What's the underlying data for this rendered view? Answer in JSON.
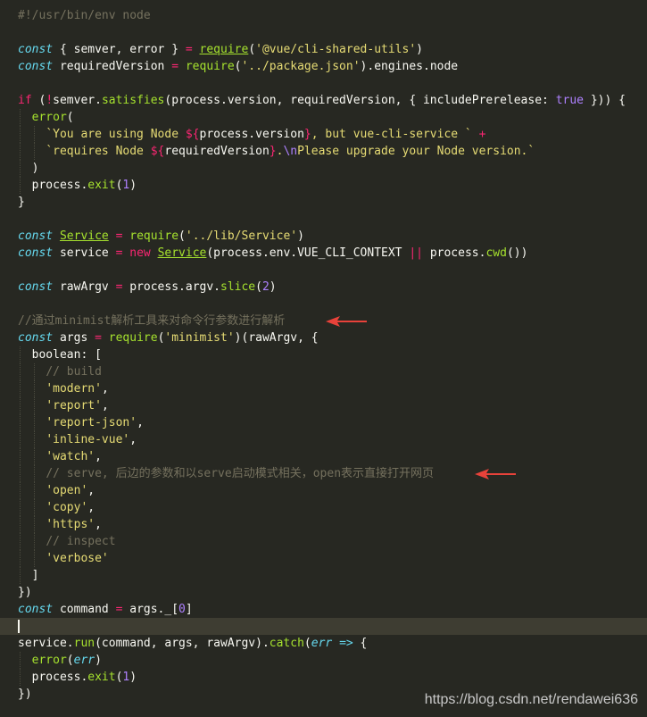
{
  "editor": {
    "theme_colors": {
      "background": "#272822",
      "keyword": "#f92672",
      "storage": "#66d9ef",
      "function": "#a6e22e",
      "string": "#e6db74",
      "comment": "#75715e",
      "number": "#ae81ff",
      "annotation_arrow": "#e8423a"
    },
    "lines": [
      {
        "tokens": [
          {
            "t": "c",
            "v": "#!/usr/bin/env node"
          }
        ]
      },
      {
        "tokens": []
      },
      {
        "tokens": [
          {
            "t": "st",
            "v": "const"
          },
          {
            "t": "p",
            "v": " { semver, error } "
          },
          {
            "t": "kw",
            "v": "="
          },
          {
            "t": "p",
            "v": " "
          },
          {
            "t": "fn",
            "v": "require",
            "u": true
          },
          {
            "t": "p",
            "v": "("
          },
          {
            "t": "s",
            "v": "'@vue/cli-shared-utils'"
          },
          {
            "t": "p",
            "v": ")"
          }
        ]
      },
      {
        "tokens": [
          {
            "t": "st",
            "v": "const"
          },
          {
            "t": "p",
            "v": " requiredVersion "
          },
          {
            "t": "kw",
            "v": "="
          },
          {
            "t": "p",
            "v": " "
          },
          {
            "t": "fn",
            "v": "require"
          },
          {
            "t": "p",
            "v": "("
          },
          {
            "t": "s",
            "v": "'../package.json'"
          },
          {
            "t": "p",
            "v": ").engines.node"
          }
        ]
      },
      {
        "tokens": []
      },
      {
        "tokens": [
          {
            "t": "kw",
            "v": "if"
          },
          {
            "t": "p",
            "v": " ("
          },
          {
            "t": "kw",
            "v": "!"
          },
          {
            "t": "p",
            "v": "semver."
          },
          {
            "t": "fn",
            "v": "satisfies"
          },
          {
            "t": "p",
            "v": "(process.version, requiredVersion, { includePrerelease: "
          },
          {
            "t": "n",
            "v": "true"
          },
          {
            "t": "p",
            "v": " })) {"
          }
        ]
      },
      {
        "guides": [
          1
        ],
        "tokens": [
          {
            "t": "p",
            "v": "  "
          },
          {
            "t": "fn",
            "v": "error"
          },
          {
            "t": "p",
            "v": "("
          }
        ]
      },
      {
        "guides": [
          1,
          2
        ],
        "tokens": [
          {
            "t": "p",
            "v": "    "
          },
          {
            "t": "s",
            "v": "`You are using Node "
          },
          {
            "t": "kw",
            "v": "${"
          },
          {
            "t": "p",
            "v": "process.version"
          },
          {
            "t": "kw",
            "v": "}"
          },
          {
            "t": "s",
            "v": ", but vue-cli-service ` "
          },
          {
            "t": "kw",
            "v": "+"
          }
        ]
      },
      {
        "guides": [
          1,
          2
        ],
        "tokens": [
          {
            "t": "p",
            "v": "    "
          },
          {
            "t": "s",
            "v": "`requires Node "
          },
          {
            "t": "kw",
            "v": "${"
          },
          {
            "t": "p",
            "v": "requiredVersion"
          },
          {
            "t": "kw",
            "v": "}"
          },
          {
            "t": "s",
            "v": "."
          },
          {
            "t": "n",
            "v": "\\n"
          },
          {
            "t": "s",
            "v": "Please upgrade your Node version.`"
          }
        ]
      },
      {
        "guides": [
          1
        ],
        "tokens": [
          {
            "t": "p",
            "v": "  )"
          }
        ]
      },
      {
        "guides": [
          1
        ],
        "tokens": [
          {
            "t": "p",
            "v": "  process."
          },
          {
            "t": "fn",
            "v": "exit"
          },
          {
            "t": "p",
            "v": "("
          },
          {
            "t": "n",
            "v": "1"
          },
          {
            "t": "p",
            "v": ")"
          }
        ]
      },
      {
        "tokens": [
          {
            "t": "p",
            "v": "}"
          }
        ]
      },
      {
        "tokens": []
      },
      {
        "tokens": [
          {
            "t": "st",
            "v": "const"
          },
          {
            "t": "p",
            "v": " "
          },
          {
            "t": "fn",
            "v": "Service",
            "u": true
          },
          {
            "t": "p",
            "v": " "
          },
          {
            "t": "kw",
            "v": "="
          },
          {
            "t": "p",
            "v": " "
          },
          {
            "t": "fn",
            "v": "require"
          },
          {
            "t": "p",
            "v": "("
          },
          {
            "t": "s",
            "v": "'../lib/Service'"
          },
          {
            "t": "p",
            "v": ")"
          }
        ]
      },
      {
        "tokens": [
          {
            "t": "st",
            "v": "const"
          },
          {
            "t": "p",
            "v": " service "
          },
          {
            "t": "kw",
            "v": "="
          },
          {
            "t": "p",
            "v": " "
          },
          {
            "t": "kw",
            "v": "new"
          },
          {
            "t": "p",
            "v": " "
          },
          {
            "t": "fn",
            "v": "Service",
            "u": true
          },
          {
            "t": "p",
            "v": "(process.env.VUE_CLI_CONTEXT "
          },
          {
            "t": "kw",
            "v": "||"
          },
          {
            "t": "p",
            "v": " process."
          },
          {
            "t": "fn",
            "v": "cwd"
          },
          {
            "t": "p",
            "v": "())"
          }
        ]
      },
      {
        "tokens": []
      },
      {
        "tokens": [
          {
            "t": "st",
            "v": "const"
          },
          {
            "t": "p",
            "v": " rawArgv "
          },
          {
            "t": "kw",
            "v": "="
          },
          {
            "t": "p",
            "v": " process.argv."
          },
          {
            "t": "fn",
            "v": "slice"
          },
          {
            "t": "p",
            "v": "("
          },
          {
            "t": "n",
            "v": "2"
          },
          {
            "t": "p",
            "v": ")"
          }
        ]
      },
      {
        "tokens": []
      },
      {
        "arrow": true,
        "tokens": [
          {
            "t": "c",
            "v": "//通过minimist解析工具来对命令行参数进行解析"
          }
        ]
      },
      {
        "tokens": [
          {
            "t": "st",
            "v": "const"
          },
          {
            "t": "p",
            "v": " args "
          },
          {
            "t": "kw",
            "v": "="
          },
          {
            "t": "p",
            "v": " "
          },
          {
            "t": "fn",
            "v": "require"
          },
          {
            "t": "p",
            "v": "("
          },
          {
            "t": "s",
            "v": "'minimist'"
          },
          {
            "t": "p",
            "v": ")(rawArgv, {"
          }
        ]
      },
      {
        "guides": [
          1
        ],
        "tokens": [
          {
            "t": "p",
            "v": "  boolean: ["
          }
        ]
      },
      {
        "guides": [
          1,
          2
        ],
        "tokens": [
          {
            "t": "p",
            "v": "    "
          },
          {
            "t": "c",
            "v": "// build"
          }
        ]
      },
      {
        "guides": [
          1,
          2
        ],
        "tokens": [
          {
            "t": "p",
            "v": "    "
          },
          {
            "t": "s",
            "v": "'modern'"
          },
          {
            "t": "p",
            "v": ","
          }
        ]
      },
      {
        "guides": [
          1,
          2
        ],
        "tokens": [
          {
            "t": "p",
            "v": "    "
          },
          {
            "t": "s",
            "v": "'report'"
          },
          {
            "t": "p",
            "v": ","
          }
        ]
      },
      {
        "guides": [
          1,
          2
        ],
        "tokens": [
          {
            "t": "p",
            "v": "    "
          },
          {
            "t": "s",
            "v": "'report-json'"
          },
          {
            "t": "p",
            "v": ","
          }
        ]
      },
      {
        "guides": [
          1,
          2
        ],
        "tokens": [
          {
            "t": "p",
            "v": "    "
          },
          {
            "t": "s",
            "v": "'inline-vue'"
          },
          {
            "t": "p",
            "v": ","
          }
        ]
      },
      {
        "guides": [
          1,
          2
        ],
        "tokens": [
          {
            "t": "p",
            "v": "    "
          },
          {
            "t": "s",
            "v": "'watch'"
          },
          {
            "t": "p",
            "v": ","
          }
        ]
      },
      {
        "guides": [
          1,
          2
        ],
        "arrow": true,
        "tokens": [
          {
            "t": "p",
            "v": "    "
          },
          {
            "t": "c",
            "v": "// serve, 后边的参数和以serve启动模式相关，open表示直接打开网页"
          }
        ]
      },
      {
        "guides": [
          1,
          2
        ],
        "tokens": [
          {
            "t": "p",
            "v": "    "
          },
          {
            "t": "s",
            "v": "'open'"
          },
          {
            "t": "p",
            "v": ","
          }
        ]
      },
      {
        "guides": [
          1,
          2
        ],
        "tokens": [
          {
            "t": "p",
            "v": "    "
          },
          {
            "t": "s",
            "v": "'copy'"
          },
          {
            "t": "p",
            "v": ","
          }
        ]
      },
      {
        "guides": [
          1,
          2
        ],
        "tokens": [
          {
            "t": "p",
            "v": "    "
          },
          {
            "t": "s",
            "v": "'https'"
          },
          {
            "t": "p",
            "v": ","
          }
        ]
      },
      {
        "guides": [
          1,
          2
        ],
        "tokens": [
          {
            "t": "p",
            "v": "    "
          },
          {
            "t": "c",
            "v": "// inspect"
          }
        ]
      },
      {
        "guides": [
          1,
          2
        ],
        "tokens": [
          {
            "t": "p",
            "v": "    "
          },
          {
            "t": "s",
            "v": "'verbose'"
          }
        ]
      },
      {
        "guides": [
          1
        ],
        "tokens": [
          {
            "t": "p",
            "v": "  ]"
          }
        ]
      },
      {
        "tokens": [
          {
            "t": "p",
            "v": "})"
          }
        ]
      },
      {
        "tokens": [
          {
            "t": "st",
            "v": "const"
          },
          {
            "t": "p",
            "v": " command "
          },
          {
            "t": "kw",
            "v": "="
          },
          {
            "t": "p",
            "v": " args._["
          },
          {
            "t": "n",
            "v": "0"
          },
          {
            "t": "p",
            "v": "]"
          }
        ]
      },
      {
        "current": true,
        "tokens": []
      },
      {
        "tokens": [
          {
            "t": "p",
            "v": "service."
          },
          {
            "t": "fn",
            "v": "run"
          },
          {
            "t": "p",
            "v": "(command, args, rawArgv)."
          },
          {
            "t": "fn",
            "v": "catch"
          },
          {
            "t": "p",
            "v": "("
          },
          {
            "t": "st",
            "v": "err"
          },
          {
            "t": "p",
            "v": " "
          },
          {
            "t": "st",
            "v": "=>"
          },
          {
            "t": "p",
            "v": " {"
          }
        ]
      },
      {
        "guides": [
          1
        ],
        "tokens": [
          {
            "t": "p",
            "v": "  "
          },
          {
            "t": "fn",
            "v": "error"
          },
          {
            "t": "p",
            "v": "("
          },
          {
            "t": "st",
            "v": "err"
          },
          {
            "t": "p",
            "v": ")"
          }
        ]
      },
      {
        "guides": [
          1
        ],
        "tokens": [
          {
            "t": "p",
            "v": "  process."
          },
          {
            "t": "fn",
            "v": "exit"
          },
          {
            "t": "p",
            "v": "("
          },
          {
            "t": "n",
            "v": "1"
          },
          {
            "t": "p",
            "v": ")"
          }
        ]
      },
      {
        "tokens": [
          {
            "t": "p",
            "v": "})"
          }
        ]
      }
    ]
  },
  "watermark": "https://blog.csdn.net/rendawei636"
}
